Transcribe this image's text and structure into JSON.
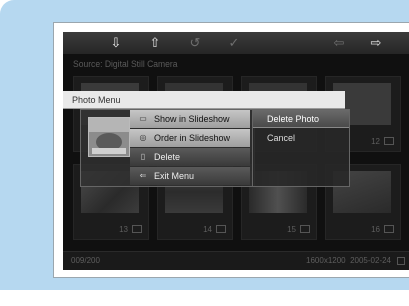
{
  "toolbar": {
    "items": [
      {
        "icon": "down-arrow-icon",
        "glyph": "⇩"
      },
      {
        "icon": "up-arrow-icon",
        "glyph": "⇧"
      },
      {
        "icon": "rotate-icon",
        "glyph": "↺"
      },
      {
        "icon": "check-icon",
        "glyph": "✓"
      },
      {
        "icon": "left-arrow-icon",
        "glyph": "⇦"
      },
      {
        "icon": "right-arrow-icon",
        "glyph": "⇨"
      }
    ]
  },
  "source_label": "Source: Digital Still Camera",
  "thumbnails": [
    {
      "number": "12"
    },
    {
      "number": "13"
    },
    {
      "number": "14"
    },
    {
      "number": "15"
    },
    {
      "number": "16"
    }
  ],
  "status": {
    "position": "009/200",
    "resolution": "1600x1200",
    "date": "2005-02-24"
  },
  "photo_menu": {
    "title": "Photo Menu",
    "items": [
      {
        "label": "Show in Slideshow",
        "icon": "slideshow-icon"
      },
      {
        "label": "Order in Slideshow",
        "icon": "order-icon"
      },
      {
        "label": "Delete",
        "icon": "trash-icon"
      },
      {
        "label": "Exit Menu",
        "icon": "exit-icon"
      }
    ]
  },
  "submenu": {
    "items": [
      {
        "label": "Delete Photo"
      },
      {
        "label": "Cancel"
      }
    ]
  }
}
